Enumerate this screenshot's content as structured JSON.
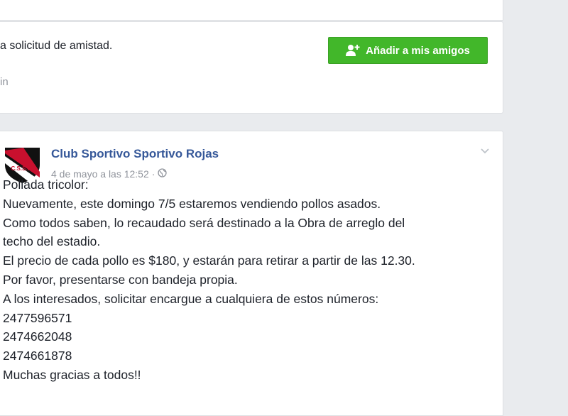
{
  "friend_request": {
    "text": "a solicitud de amistad.",
    "sub_text": "in",
    "add_button_label": "Añadir a mis amigos",
    "add_button_icon": "add-friend-icon",
    "button_color": "#42b72a"
  },
  "post": {
    "author": "Club Sportivo Sportivo Rojas",
    "timestamp": "4 de mayo a las 12:52",
    "separator": "·",
    "privacy_icon": "globe-icon",
    "menu_icon": "chevron-down-icon",
    "avatar_text": "C.S.S.R.",
    "lines": [
      "Pollada tricolor:",
      "Nuevamente, este domingo 7/5 estaremos vendiendo pollos asados.",
      "Como todos saben, lo recaudado será destinado a la Obra de arreglo del",
      "techo del estadio.",
      "El precio de cada pollo es $180, y estarán para retirar a partir de las 12.30.",
      "Por favor, presentarse con bandeja propia.",
      "A los interesados, solicitar encargue a cualquiera de estos números:",
      "2477596571",
      "2474662048",
      "2474661878",
      "Muchas gracias a todos!!"
    ],
    "author_color": "#365899"
  }
}
